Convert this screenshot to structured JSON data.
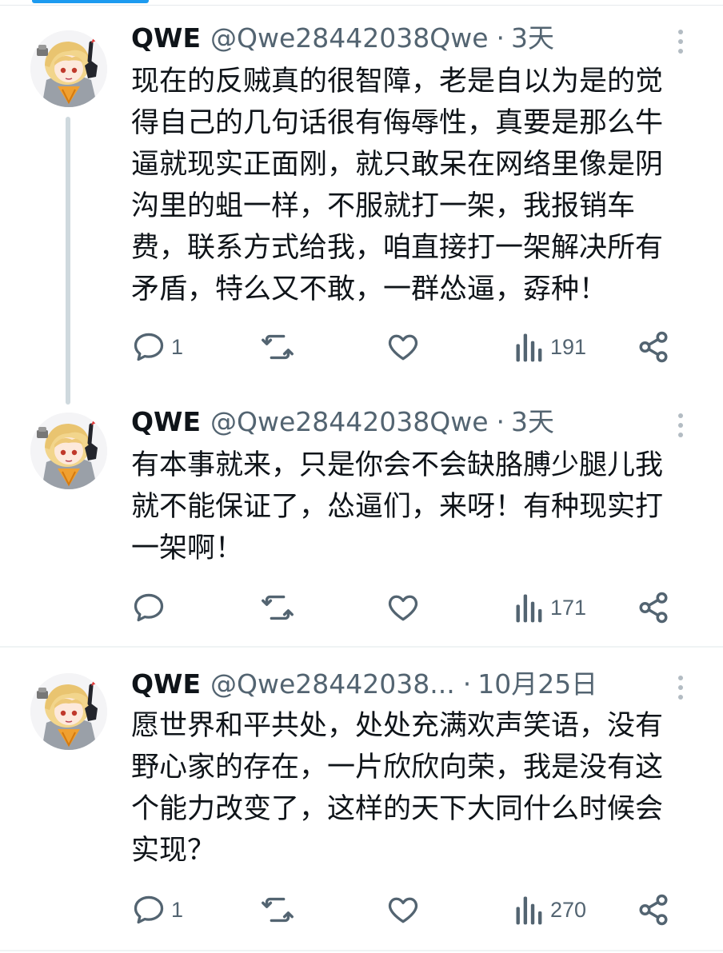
{
  "tweets": [
    {
      "author": "QWE",
      "handle": "@Qwe28442038Qwe",
      "separator": "·",
      "time": "3天",
      "text": "现在的反贼真的很智障，老是自以为是的觉\n得自己的几句话很有侮辱性，真要是那么牛\n逼就现实正面刚，就只敢呆在网络里像是阴\n沟里的蛆一样，不服就打一架，我报销车\n费，联系方式给我，咱直接打一架解决所有\n矛盾，特么又不敢，一群怂逼，孬种！",
      "reply_count": "1",
      "view_count": "191"
    },
    {
      "author": "QWE",
      "handle": "@Qwe28442038Qwe",
      "separator": "·",
      "time": "3天",
      "text": "有本事就来，只是你会不会缺胳膊少腿儿我\n就不能保证了，怂逼们，来呀！有种现实打\n一架啊！",
      "reply_count": "",
      "view_count": "171"
    },
    {
      "author": "QWE",
      "handle": "@Qwe28442038...",
      "separator": "·",
      "time": "10月25日",
      "text": "愿世界和平共处，处处充满欢声笑语，没有\n野心家的存在，一片欣欣向荣，我是没有这\n个能力改变了，这样的天下大同什么时候会\n实现？",
      "reply_count": "1",
      "view_count": "270"
    }
  ],
  "colors": {
    "accent": "#1d9bf0",
    "icon": "#536471",
    "text": "#0f1419",
    "thread_line": "#cfd9de"
  },
  "icons": [
    "reply-icon",
    "retweet-icon",
    "like-icon",
    "views-icon",
    "share-icon",
    "more-icon"
  ]
}
